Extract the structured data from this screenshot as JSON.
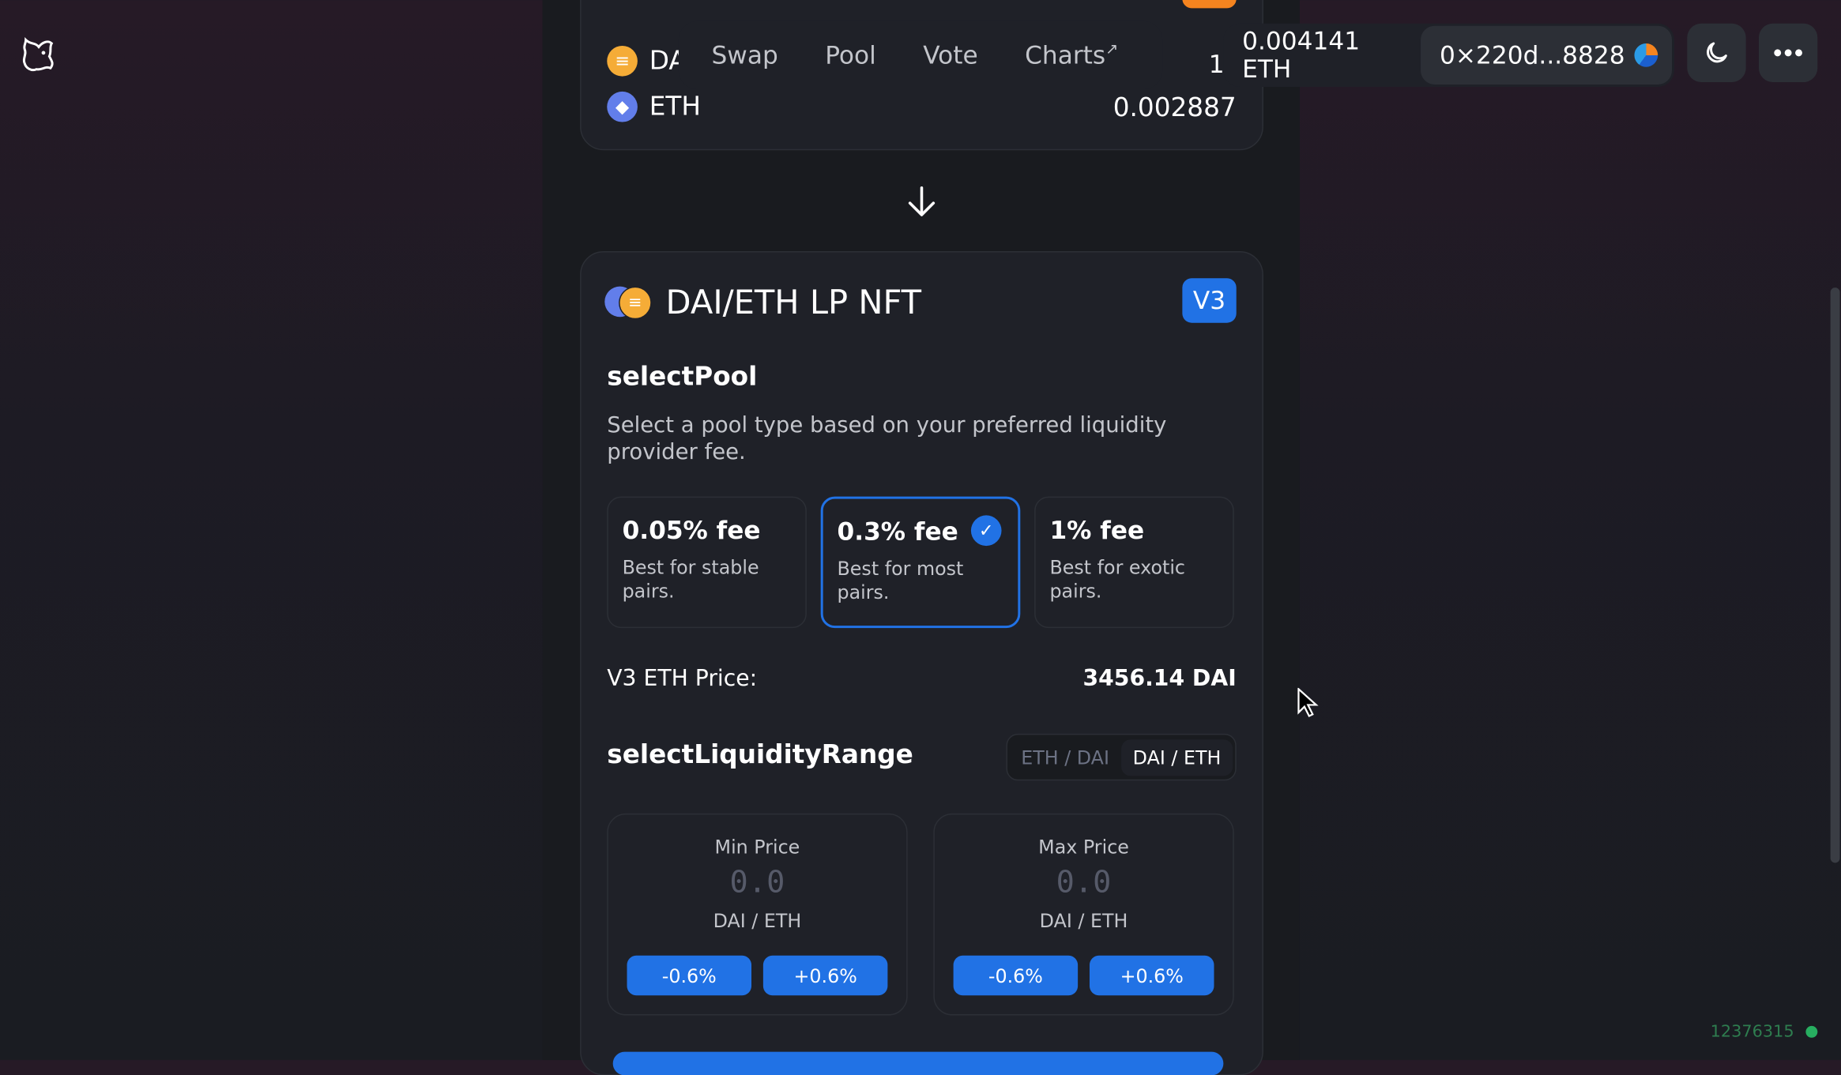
{
  "nav": {
    "swap": "Swap",
    "pool": "Pool",
    "vote": "Vote",
    "charts": "Charts",
    "charts_ext": "↗"
  },
  "account": {
    "balance": "0.004141 ETH",
    "address": "0×220d...8828"
  },
  "top_card": {
    "rows": [
      {
        "symbol": "DA",
        "value": "1("
      },
      {
        "symbol": "ETH",
        "value": "0.002887"
      }
    ]
  },
  "pool_card": {
    "title": "DAI/ETH LP NFT",
    "version": "V3",
    "select_pool_heading": "selectPool",
    "select_pool_desc": "Select a pool type based on your preferred liquidity provider fee.",
    "fees": [
      {
        "label": "0.05% fee",
        "desc": "Best for stable pairs.",
        "selected": false
      },
      {
        "label": "0.3% fee",
        "desc": "Best for most pairs.",
        "selected": true
      },
      {
        "label": "1% fee",
        "desc": "Best for exotic pairs.",
        "selected": false
      }
    ],
    "price_label": "V3 ETH Price:",
    "price_value": "3456.14 DAI",
    "range_heading": "selectLiquidityRange",
    "toggle": {
      "left": "ETH / DAI",
      "right": "DAI / ETH",
      "active": "right"
    },
    "min": {
      "label": "Min Price",
      "value": "0.0",
      "unit": "DAI / ETH",
      "dec": "-0.6%",
      "inc": "+0.6%"
    },
    "max": {
      "label": "Max Price",
      "value": "0.0",
      "unit": "DAI / ETH",
      "dec": "-0.6%",
      "inc": "+0.6%"
    }
  },
  "block_number": "12376315",
  "colors": {
    "accent": "#2172e5",
    "orange": "#f5841f",
    "dai": "#f5ac37",
    "eth": "#627eea",
    "status": "#27ae60"
  }
}
